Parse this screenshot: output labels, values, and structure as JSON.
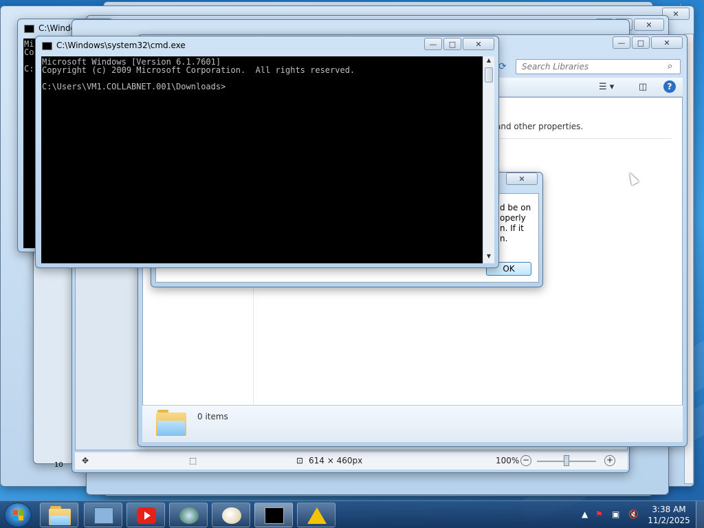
{
  "background_windows": {
    "cmd_back_title": "C:\\Windows\\syste",
    "cmd_back_snippet_line1": "Mi",
    "cmd_back_snippet_line2": "Co",
    "cmd_back_snippet_line3": "C:"
  },
  "cmd_window": {
    "title": "C:\\Windows\\system32\\cmd.exe",
    "lines": [
      "Microsoft Windows [Version 6.1.7601]",
      "Copyright (c) 2009 Microsoft Corporation.  All rights reserved.",
      "",
      "C:\\Users\\VM1.COLLABNET.001\\Downloads>"
    ]
  },
  "explorer": {
    "search_placeholder": "Search Libraries",
    "hint_text": "and other properties.",
    "items_count": "0 items"
  },
  "dialog": {
    "message_lines": [
      "d be on",
      "operly",
      "n. If it",
      "n."
    ],
    "ok_label": "OK"
  },
  "paint": {
    "dimensions": "614 × 460px",
    "zoom": "100%",
    "zoom_minus": "−",
    "zoom_plus": "+",
    "page_number": "10"
  },
  "taskbar": {
    "time": "3:38 AM",
    "date": "11/2/2025"
  },
  "colors": {
    "console_bg": "#000000",
    "console_text": "#c0c0c0",
    "taskbar": "#1f4a7a"
  }
}
